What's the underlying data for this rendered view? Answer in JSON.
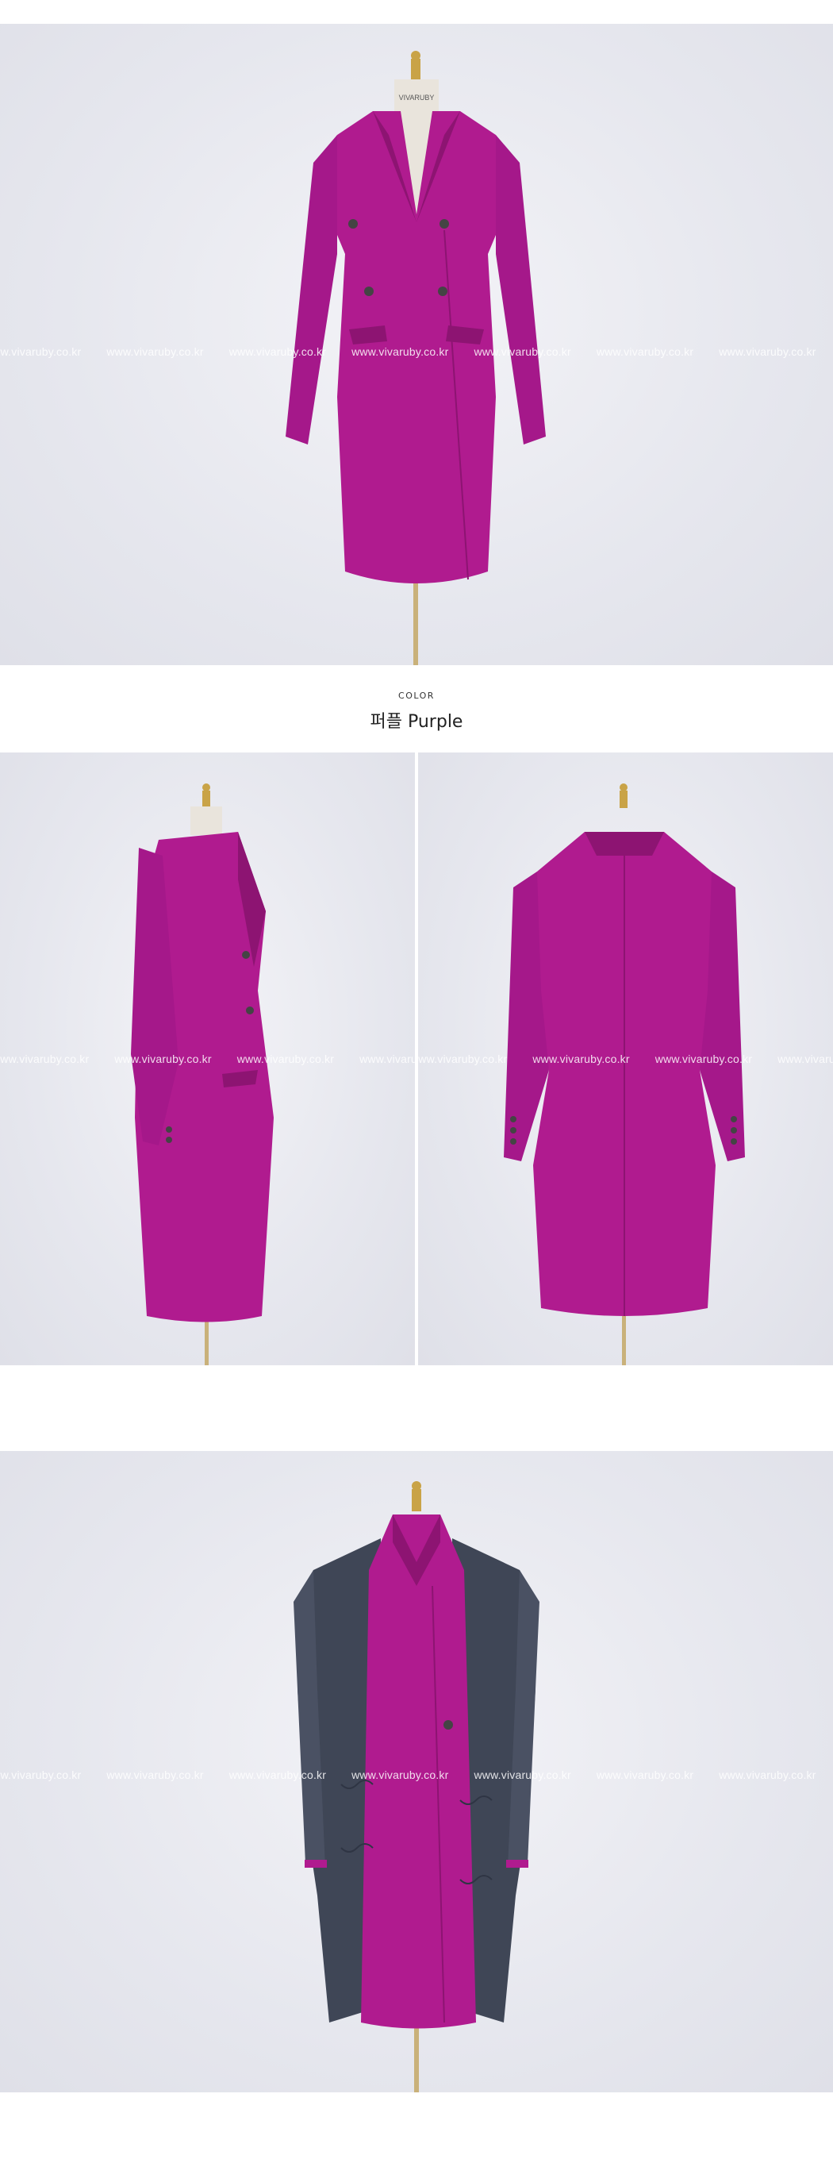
{
  "watermark_text": "www.vivaruby.co.kr",
  "mannequin_tag": "VIVARUBY",
  "color_section": {
    "label": "COLOR",
    "name": "퍼플 Purple"
  },
  "colors": {
    "coat": "#b01b8f",
    "coat_dark": "#8d1472",
    "lining": "#3f4656",
    "background": "#e8e9ef",
    "brass": "#c9a347"
  },
  "photos": [
    {
      "view": "front"
    },
    {
      "view": "side"
    },
    {
      "view": "back"
    },
    {
      "view": "detail"
    }
  ]
}
